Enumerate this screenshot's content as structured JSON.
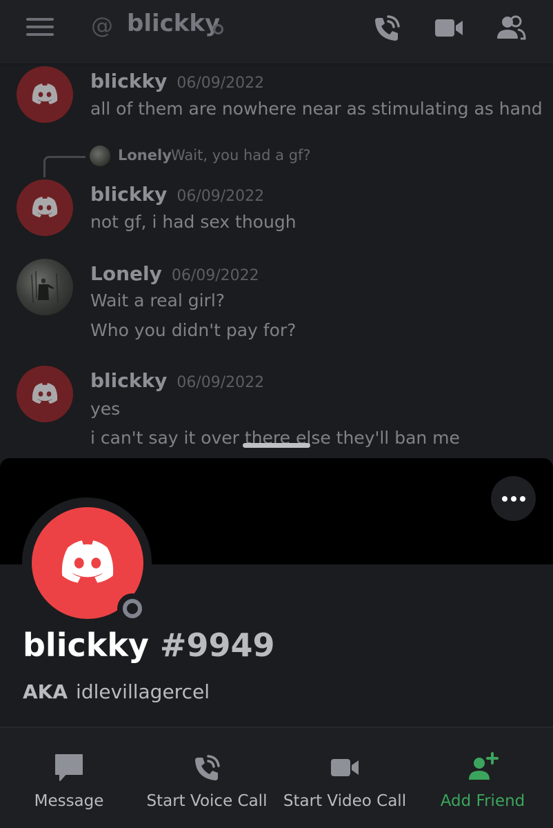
{
  "header": {
    "at_symbol": "@",
    "title": "blickky",
    "icons": [
      "menu-icon",
      "phone-call-icon",
      "video-camera-icon",
      "members-icon"
    ]
  },
  "messages": [
    {
      "author": "blickky",
      "time": "06/09/2022",
      "lines": [
        "all of them are nowhere near as stimulating as hand"
      ]
    },
    {
      "reply_to": {
        "author": "Lonely",
        "text": "Wait, you had a gf?"
      },
      "author": "blickky",
      "time": "06/09/2022",
      "lines": [
        "not gf, i had sex though"
      ]
    },
    {
      "author": "Lonely",
      "time": "06/09/2022",
      "lines": [
        "Wait a real girl?",
        "Who you didn't pay for?"
      ]
    },
    {
      "author": "blickky",
      "time": "06/09/2022",
      "lines": [
        "yes",
        "i can't say it over there else they'll ban me"
      ]
    }
  ],
  "profile": {
    "username": "blickky",
    "tag": "#9949",
    "aka_label": "AKA",
    "aka_value": "idlevillagercel",
    "status": "offline"
  },
  "actions": [
    {
      "label": "Message",
      "icon": "message-icon"
    },
    {
      "label": "Start Voice Call",
      "icon": "phone-call-icon"
    },
    {
      "label": "Start Video Call",
      "icon": "video-camera-icon"
    },
    {
      "label": "Add Friend",
      "icon": "add-friend-icon"
    }
  ],
  "colors": {
    "brand_red": "#ed4245",
    "accent_green": "#3ba55d",
    "background": "#1b1c1f"
  }
}
